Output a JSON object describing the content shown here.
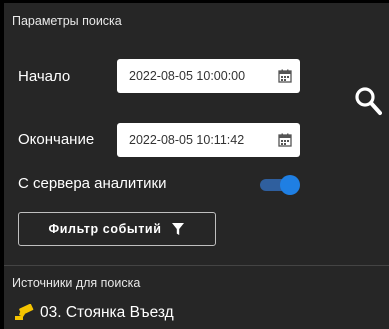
{
  "search_params": {
    "section_title": "Параметры поиска",
    "start_label": "Начало",
    "start_value": "2022-08-05 10:00:00",
    "end_label": "Окончание",
    "end_value": "2022-08-05 10:11:42",
    "analytics_label": "С сервера аналитики",
    "analytics_enabled": true,
    "filter_button_label": "Фильтр событий"
  },
  "sources": {
    "section_title": "Источники для поиска",
    "items": [
      {
        "label": "03. Стоянка Въезд",
        "icon": "camera-icon"
      }
    ]
  },
  "colors": {
    "background": "#262626",
    "accent": "#1f7fe3",
    "camera_icon": "#f5c400"
  }
}
